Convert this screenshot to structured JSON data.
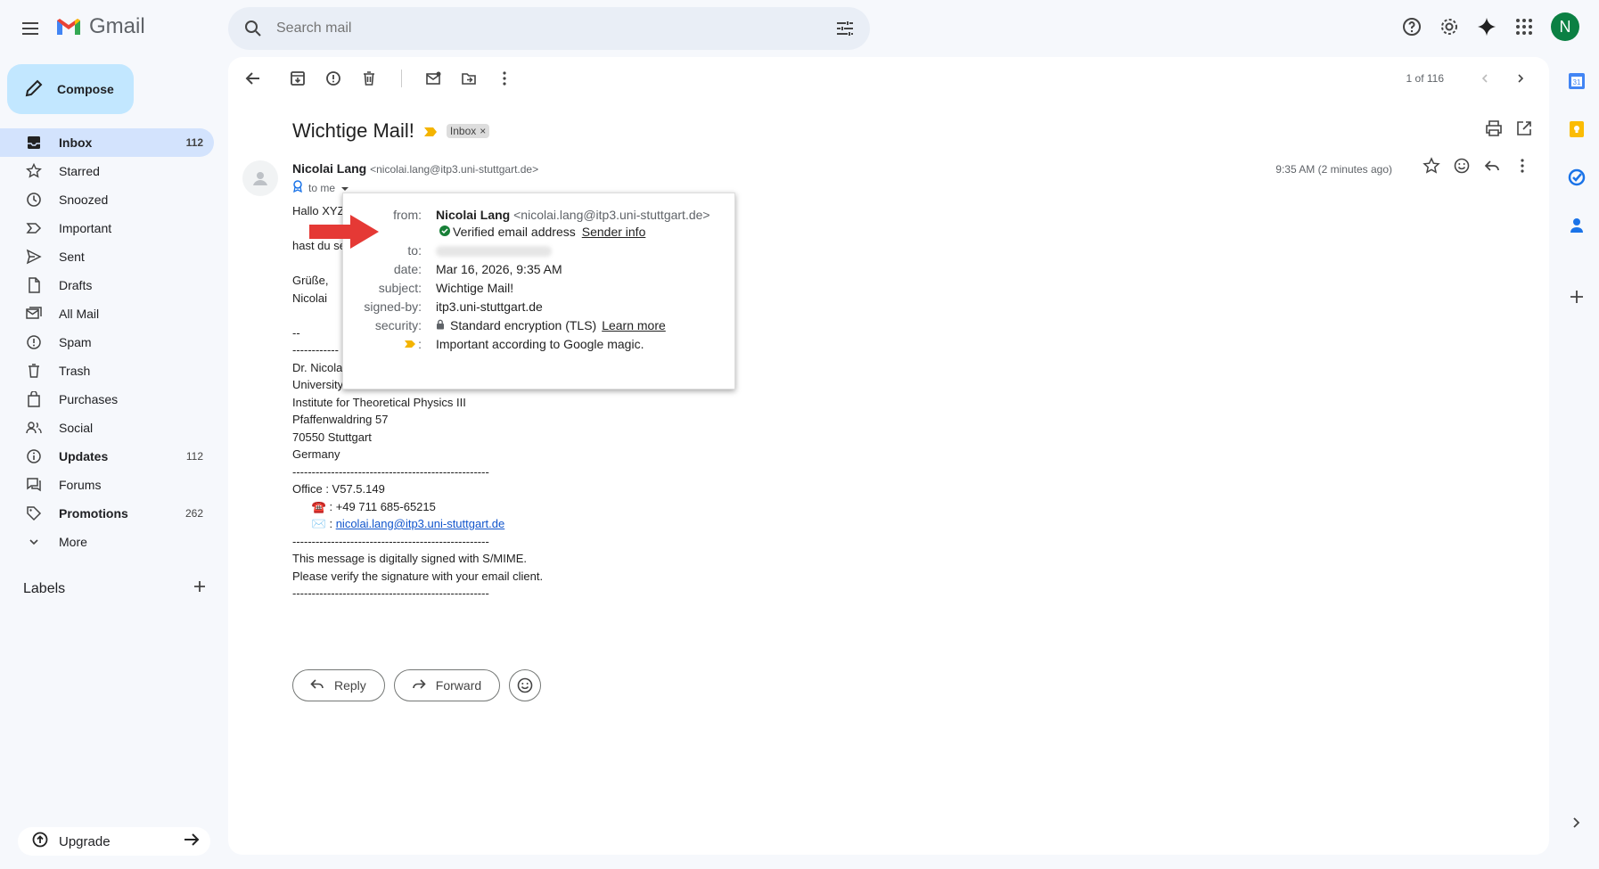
{
  "app": {
    "name": "Gmail",
    "avatar_letter": "N"
  },
  "search": {
    "placeholder": "Search mail"
  },
  "compose_label": "Compose",
  "nav": [
    {
      "label": "Inbox",
      "count": "112",
      "active": true,
      "bold": true,
      "icon": "inbox-icon"
    },
    {
      "label": "Starred",
      "count": "",
      "icon": "star-icon"
    },
    {
      "label": "Snoozed",
      "count": "",
      "icon": "clock-icon"
    },
    {
      "label": "Important",
      "count": "",
      "icon": "important-icon"
    },
    {
      "label": "Sent",
      "count": "",
      "icon": "send-icon"
    },
    {
      "label": "Drafts",
      "count": "",
      "icon": "draft-icon"
    },
    {
      "label": "All Mail",
      "count": "",
      "icon": "all-mail-icon"
    },
    {
      "label": "Spam",
      "count": "",
      "icon": "spam-icon"
    },
    {
      "label": "Trash",
      "count": "",
      "icon": "trash-icon"
    },
    {
      "label": "Purchases",
      "count": "",
      "icon": "bag-icon"
    },
    {
      "label": "Social",
      "count": "",
      "icon": "people-icon"
    },
    {
      "label": "Updates",
      "count": "112",
      "bold": true,
      "icon": "info-icon"
    },
    {
      "label": "Forums",
      "count": "",
      "icon": "forum-icon"
    },
    {
      "label": "Promotions",
      "count": "262",
      "bold": true,
      "icon": "tag-icon"
    },
    {
      "label": "More",
      "count": "",
      "icon": "chevron-down-icon"
    }
  ],
  "labels_heading": "Labels",
  "upgrade_label": "Upgrade",
  "pager": "1 of 116",
  "email": {
    "subject": "Wichtige Mail!",
    "tag": "Inbox",
    "sender_name": "Nicolai Lang",
    "sender_addr": "<nicolai.lang@itp3.uni-stuttgart.de>",
    "to_me": "to me",
    "time": "9:35 AM (2 minutes ago)",
    "body_lines": [
      "Hallo XYZ",
      "",
      "hast du se",
      "",
      "Grüße,",
      "Nicolai",
      "",
      "--",
      "------------",
      "Dr. Nicola",
      "University",
      "Institute for Theoretical Physics III",
      "Pfaffenwaldring 57",
      "70550 Stuttgart",
      "Germany",
      "---------------------------------------------------",
      "Office : V57.5.149",
      "      ☎️ : +49 711 685-65215",
      "      ✉️ : "
    ],
    "email_link": "nicolai.lang@itp3.uni-stuttgart.de",
    "footer_lines": [
      "---------------------------------------------------",
      "This message is digitally signed with S/MIME.",
      "Please verify the signature with your email client.",
      "---------------------------------------------------"
    ],
    "reply_label": "Reply",
    "forward_label": "Forward"
  },
  "popup": {
    "from_label": "from:",
    "from_name": "Nicolai Lang",
    "from_addr": "<nicolai.lang@itp3.uni-stuttgart.de>",
    "verified": "Verified email address",
    "sender_info": "Sender info",
    "to_label": "to:",
    "date_label": "date:",
    "date": "Mar 16, 2026, 9:35 AM",
    "subject_label": "subject:",
    "subject": "Wichtige Mail!",
    "signed_label": "signed-by:",
    "signed": "itp3.uni-stuttgart.de",
    "security_label": "security:",
    "security": "Standard encryption (TLS)",
    "learn_more": "Learn more",
    "important_suffix": ":",
    "important": "Important according to Google magic."
  },
  "colors": {
    "accent": "#0b57d0",
    "compose": "#c2e7ff",
    "nav_active": "#d3e3fd",
    "arrow": "#e53935"
  }
}
